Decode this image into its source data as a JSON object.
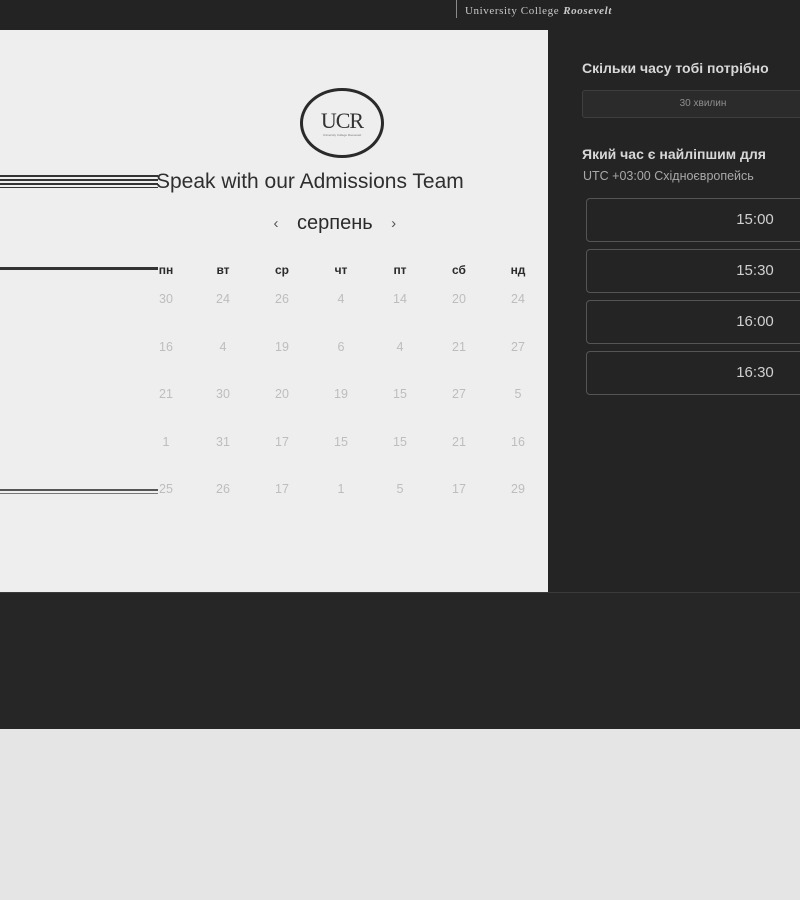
{
  "header": {
    "brand_text": "University College",
    "brand_emph": "Roosevelt"
  },
  "logo": {
    "mark": "UCR",
    "sub": "University College Roosevelt"
  },
  "booking": {
    "title": "Speak with our Admissions Team",
    "month": "серпень",
    "prev_icon": "‹",
    "next_icon": "›",
    "weekdays": [
      "пн",
      "вт",
      "ср",
      "чт",
      "пт",
      "сб",
      "нд"
    ],
    "weeks": [
      [
        "30",
        "24",
        "26",
        "4",
        "14",
        "20",
        "24"
      ],
      [
        "16",
        "4",
        "19",
        "6",
        "4",
        "21",
        "27"
      ],
      [
        "21",
        "30",
        "20",
        "19",
        "15",
        "27",
        "5"
      ],
      [
        "1",
        "31",
        "17",
        "15",
        "15",
        "21",
        "16"
      ],
      [
        "25",
        "26",
        "17",
        "1",
        "5",
        "17",
        "29"
      ]
    ]
  },
  "scheduler": {
    "duration_question": "Скільки часу тобі потрібно",
    "duration_value": "30 хвилин",
    "time_question": "Який час є найліпшим для",
    "timezone": "UTC +03:00 Східноєвропейсь",
    "slots": [
      "15:00",
      "15:30",
      "16:00",
      "16:30"
    ]
  }
}
